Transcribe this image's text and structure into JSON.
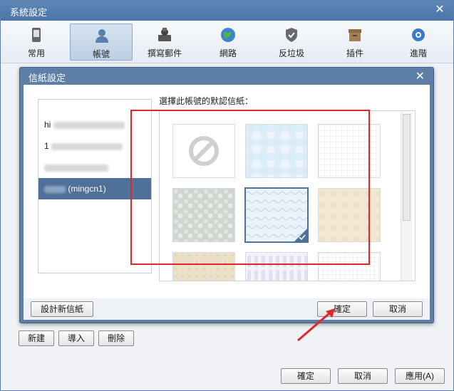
{
  "window": {
    "title": "系統設定"
  },
  "toolbar": {
    "items": [
      {
        "label": "常用",
        "icon": "phone-icon"
      },
      {
        "label": "帳號",
        "icon": "user-icon"
      },
      {
        "label": "撰寫郵件",
        "icon": "compose-mail-icon"
      },
      {
        "label": "網路",
        "icon": "globe-icon"
      },
      {
        "label": "反垃圾",
        "icon": "shield-icon"
      },
      {
        "label": "插件",
        "icon": "plugin-box-icon"
      },
      {
        "label": "進階",
        "icon": "gear-icon"
      }
    ],
    "active": "帳號"
  },
  "dialog": {
    "title": "信紙設定",
    "prompt": "選擇此帳號的默認信紙：",
    "accounts": [
      "hi",
      "1",
      "",
      "(mingcn1)"
    ],
    "selected_account": "(mingcn1)",
    "stationery": [
      {
        "name": "none"
      },
      {
        "name": "blue-plaid"
      },
      {
        "name": "grid"
      },
      {
        "name": "gray-stone"
      },
      {
        "name": "blue-pattern",
        "selected": true
      },
      {
        "name": "parchment"
      },
      {
        "name": "beige-texture"
      },
      {
        "name": "blue-city"
      },
      {
        "name": "fine-grid"
      }
    ],
    "new_stationery_label": "設計新信紙",
    "ok_label": "確定",
    "cancel_label": "取消"
  },
  "outer_buttons": {
    "new_label": "新建",
    "import_label": "導入",
    "delete_label": "刪除",
    "ok_label": "確定",
    "cancel_label": "取消",
    "apply_label": "應用(A)"
  },
  "colors": {
    "title_bar": "#4b75a8",
    "dialog_frame": "#5d7ea6",
    "selection": "#4f7098",
    "highlight_annotation": "#e0262c"
  }
}
